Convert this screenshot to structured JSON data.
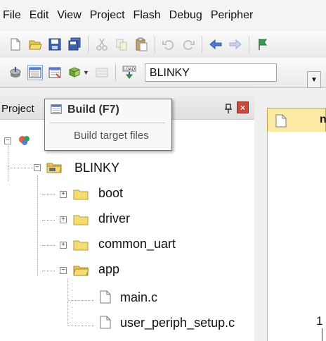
{
  "menubar": {
    "items": [
      "File",
      "Edit",
      "View",
      "Project",
      "Flash",
      "Debug",
      "Peripher"
    ]
  },
  "toolbar1": {
    "icons": [
      "new-file-icon",
      "open-folder-icon",
      "save-icon",
      "save-all-icon",
      "cut-icon",
      "copy-icon",
      "paste-icon",
      "undo-icon",
      "redo-icon",
      "navigate-back-icon",
      "navigate-forward-icon",
      "bookmark-icon"
    ]
  },
  "toolbar2": {
    "icons": [
      "translate-icon",
      "build-icon",
      "rebuild-icon",
      "batch-build-icon",
      "stop-build-icon",
      "download-icon"
    ],
    "download_icon_text": "LOAD",
    "target_value": "BLINKY"
  },
  "panel": {
    "title": "Project"
  },
  "tooltip": {
    "title": "Build (F7)",
    "description": "Build target files"
  },
  "tree": {
    "target": "BLINKY",
    "groups": [
      {
        "label": "boot",
        "expanded": false
      },
      {
        "label": "driver",
        "expanded": false
      },
      {
        "label": "common_uart",
        "expanded": false
      },
      {
        "label": "app",
        "expanded": true
      }
    ],
    "files": [
      "main.c",
      "user_periph_setup.c"
    ]
  },
  "editor": {
    "tab_label": "n",
    "line_number": "1"
  },
  "colors": {
    "folder": "#e8c94a",
    "tab_active": "#fdeaa4",
    "close_button": "#c94a3a"
  }
}
